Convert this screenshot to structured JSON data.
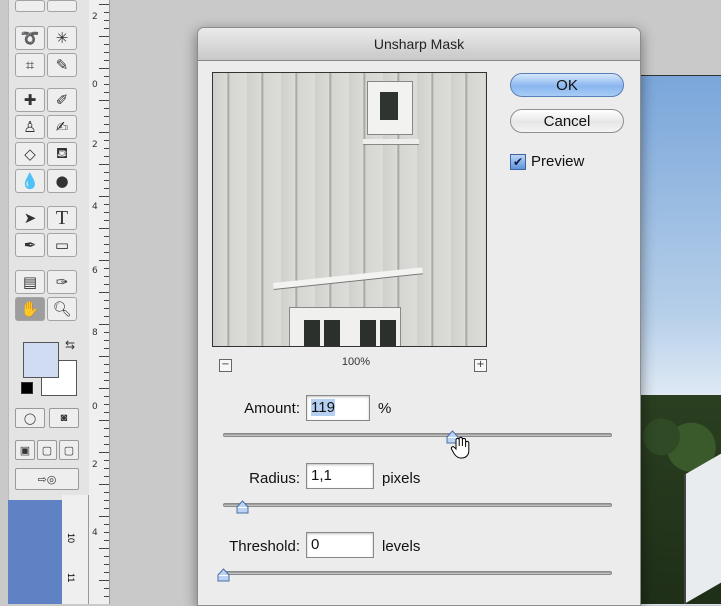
{
  "dialog": {
    "title": "Unsharp Mask",
    "ok_label": "OK",
    "cancel_label": "Cancel",
    "preview_label": "Preview",
    "preview_checked": true,
    "zoom_label": "100%",
    "zoom_minus": "−",
    "zoom_plus": "+"
  },
  "amount": {
    "label": "Amount:",
    "value": "119",
    "unit": "%",
    "slider_fraction": 0.59
  },
  "radius": {
    "label": "Radius:",
    "value": "1,1",
    "unit": "pixels",
    "slider_fraction": 0.05
  },
  "threshold": {
    "label": "Threshold:",
    "value": "0",
    "unit": "levels",
    "slider_fraction": 0.0
  },
  "toolbox": {
    "tools": [
      "lasso-icon",
      "magic-wand-icon",
      "crop-icon",
      "slice-icon",
      "healing-brush-icon",
      "brush-icon",
      "clone-stamp-icon",
      "history-brush-icon",
      "eraser-icon",
      "paint-bucket-icon",
      "blur-icon",
      "dodge-icon",
      "path-selection-icon",
      "type-icon",
      "pen-icon",
      "rectangle-icon",
      "notes-icon",
      "eyedropper-icon",
      "hand-icon",
      "zoom-icon"
    ],
    "type_tool_glyph": "T",
    "foreground_color": "#cfdcf2",
    "background_color": "#ffffff"
  },
  "ruler": {
    "labels": [
      "2",
      "0",
      "2",
      "4",
      "6",
      "8",
      "0",
      "2",
      "4"
    ],
    "bottom_labels": [
      "10",
      "11"
    ]
  }
}
